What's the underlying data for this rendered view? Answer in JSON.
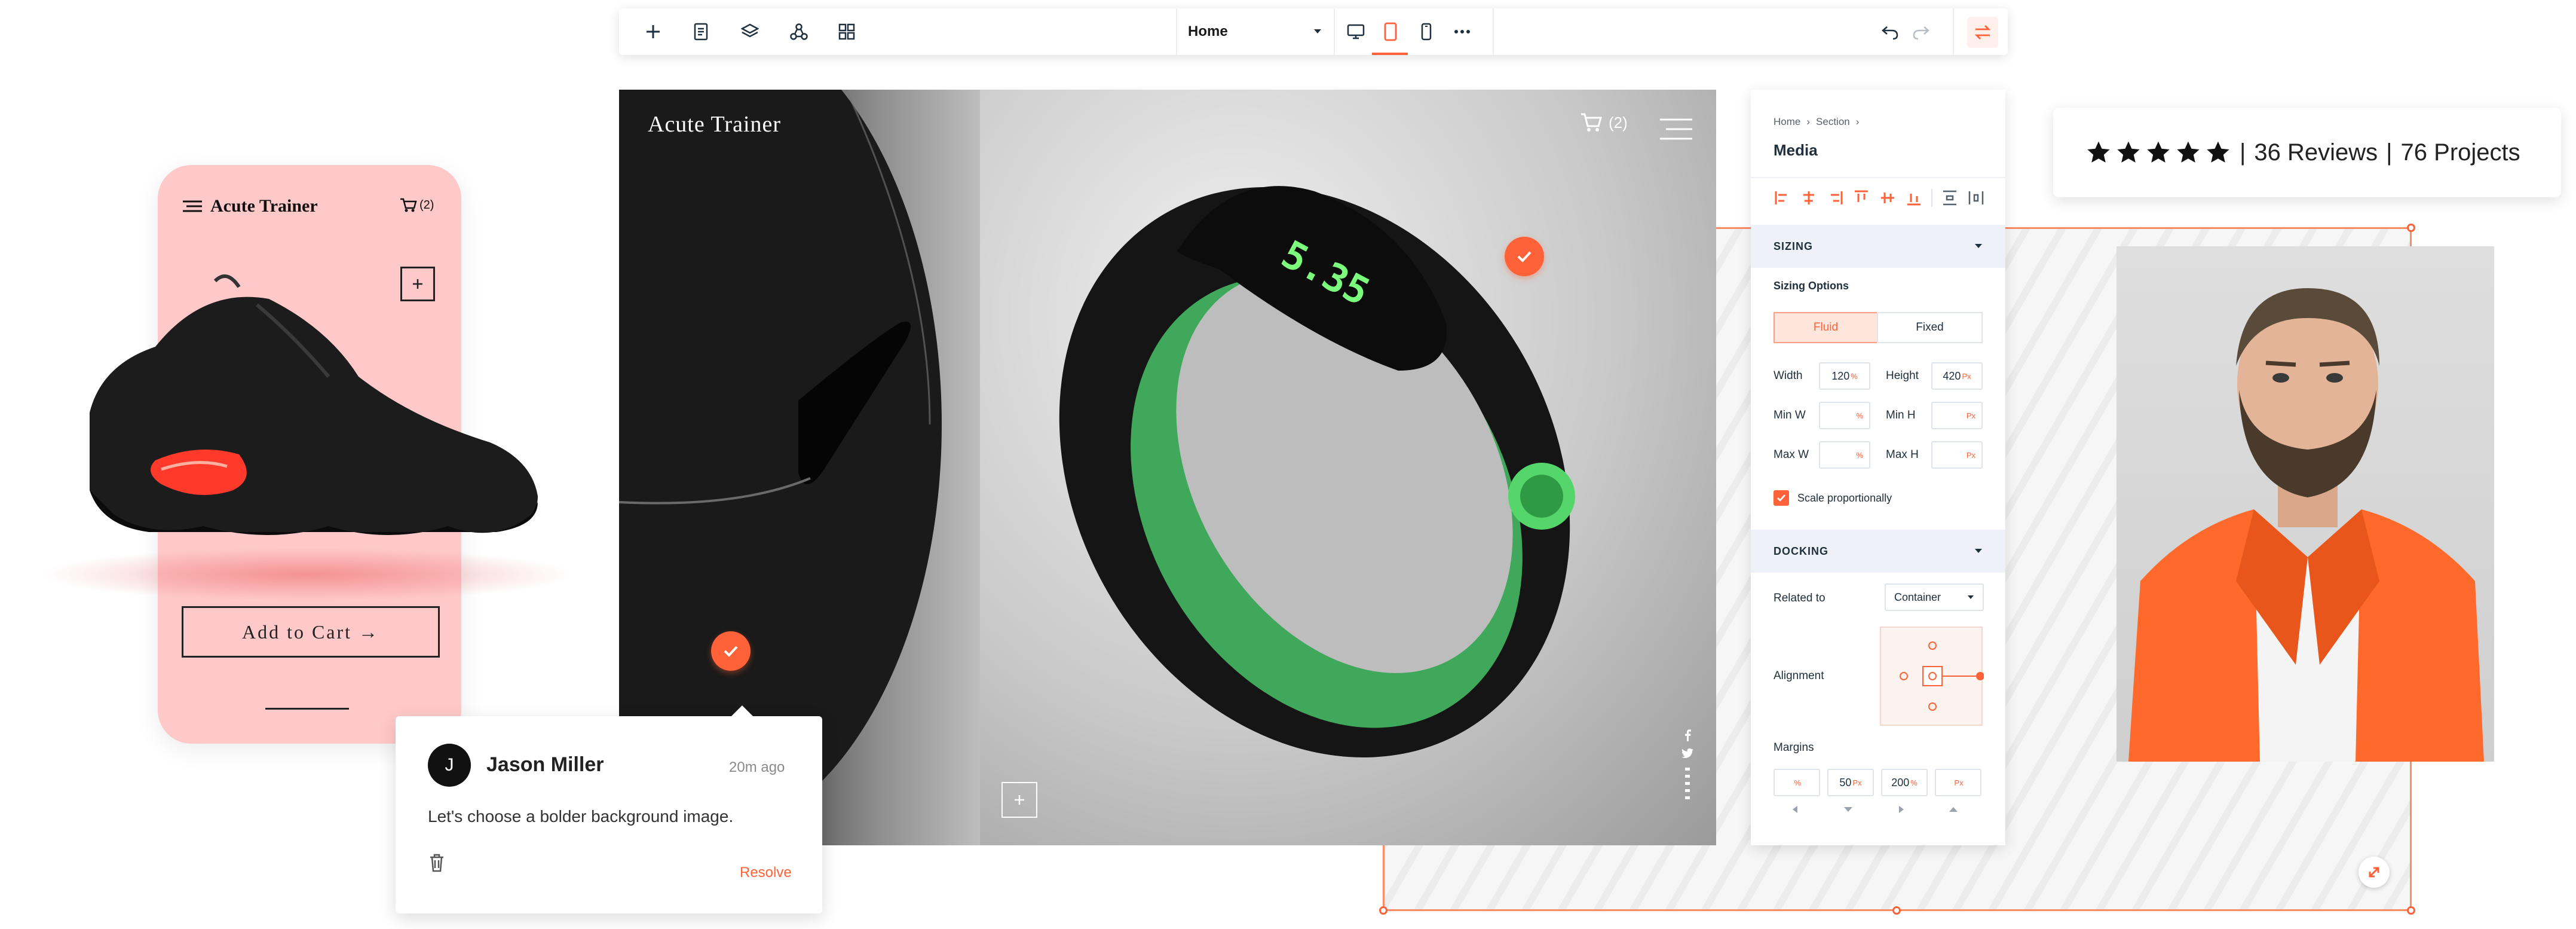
{
  "colors": {
    "accent": "#ff6138",
    "panel_section_bg": "#eef1f8",
    "phone_bg": "#ffc9c9"
  },
  "toolbar": {
    "left_icons": [
      "plus-icon",
      "page-icon",
      "layers-icon",
      "share-nodes-icon",
      "apps-grid-icon"
    ],
    "page_select": "Home",
    "device_icons": [
      "desktop-icon",
      "tablet-icon",
      "mobile-icon",
      "more-icon"
    ],
    "right_icons": [
      "undo-icon",
      "redo-icon",
      "settings-swap-icon"
    ]
  },
  "canvas": {
    "site_title": "Acute Trainer",
    "cart_count": "(2)",
    "social_icons": [
      "facebook-icon",
      "twitter-icon",
      "dots-icon"
    ]
  },
  "panel": {
    "breadcrumb": [
      "Home",
      "Section"
    ],
    "title": "Media",
    "sizing": {
      "header": "SIZING",
      "options_label": "Sizing Options",
      "options": [
        "Fluid",
        "Fixed"
      ],
      "selected": "Fluid",
      "width_label": "Width",
      "width_value": "120",
      "width_unit": "%",
      "height_label": "Height",
      "height_value": "420",
      "height_unit": "Px",
      "minw_label": "Min W",
      "minw_unit": "%",
      "minh_label": "Min H",
      "minh_unit": "Px",
      "maxw_label": "Max W",
      "maxw_unit": "%",
      "maxh_label": "Max H",
      "maxh_unit": "Px",
      "scale_label": "Scale proportionally",
      "scale_checked": true
    },
    "docking": {
      "header": "DOCKING",
      "related_label": "Related to",
      "related_value": "Container",
      "alignment_label": "Alignment",
      "margins_label": "Margins",
      "margins": [
        {
          "value": "",
          "unit": "%"
        },
        {
          "value": "50",
          "unit": "Px"
        },
        {
          "value": "200",
          "unit": "%"
        },
        {
          "value": "",
          "unit": "Px"
        }
      ]
    }
  },
  "reviews": {
    "stars": 5,
    "reviews_text": "36 Reviews",
    "projects_text": "76 Projects",
    "separator": "|"
  },
  "phone": {
    "title": "Acute Trainer",
    "cart_count": "(2)",
    "add_to_cart": "Add to Cart →"
  },
  "comment": {
    "avatar_initial": "J",
    "name": "Jason Miller",
    "time": "20m ago",
    "text": "Let's choose a bolder background image.",
    "resolve": "Resolve"
  }
}
